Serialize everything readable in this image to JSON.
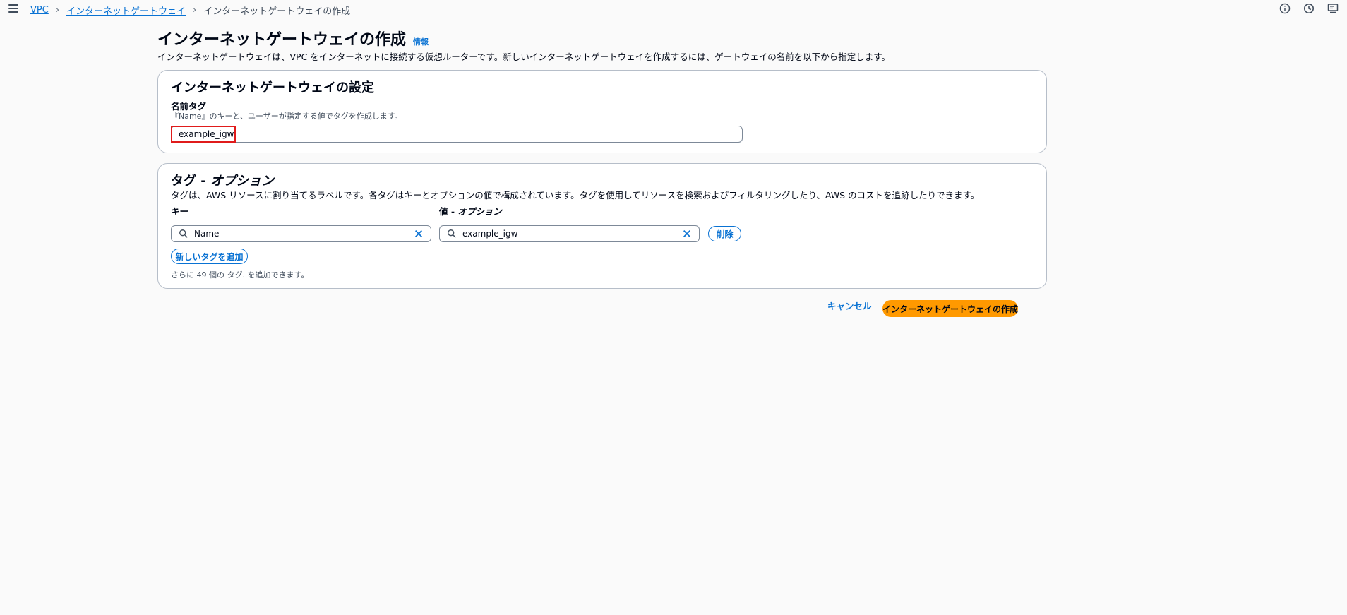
{
  "breadcrumb": {
    "items": [
      "VPC",
      "インターネットゲートウェイ"
    ],
    "current": "インターネットゲートウェイの作成"
  },
  "header": {
    "title": "インターネットゲートウェイの作成",
    "info": "情報",
    "description": "インターネットゲートウェイは、VPC をインターネットに接続する仮想ルーターです。新しいインターネットゲートウェイを作成するには、ゲートウェイの名前を以下から指定します。"
  },
  "settings": {
    "title": "インターネットゲートウェイの設定",
    "name_label": "名前タグ",
    "name_desc": "『Name』のキーと、ユーザーが指定する値でタグを作成します。",
    "name_value": "example_igw"
  },
  "tags": {
    "title_prefix": "タグ - ",
    "title_suffix": "オプション",
    "description": "タグは、AWS リソースに割り当てるラベルです。各タグはキーとオプションの値で構成されています。タグを使用してリソースを検索およびフィルタリングしたり、AWS のコストを追跡したりできます。",
    "key_label": "キー",
    "value_label_prefix": "値 - ",
    "value_label_suffix": "オプション",
    "key_value": "Name",
    "value_value": "example_igw",
    "remove_label": "削除",
    "add_label": "新しいタグを追加",
    "remaining": "さらに 49 個の タグ. を追加できます。"
  },
  "actions": {
    "cancel": "キャンセル",
    "create": "インターネットゲートウェイの作成"
  }
}
